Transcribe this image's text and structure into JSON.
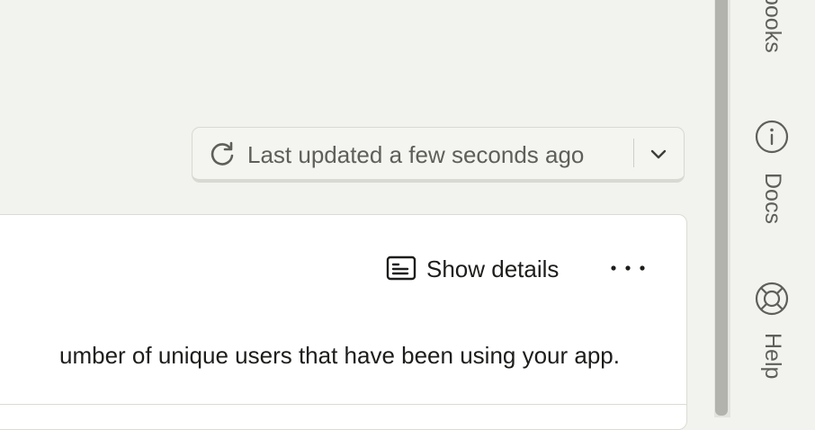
{
  "refresh": {
    "label": "Last updated a few seconds ago",
    "reload_icon": "reload-icon",
    "dropdown_icon": "chevron-down-icon"
  },
  "card": {
    "show_details_label": "Show details",
    "show_details_icon": "details-panel-icon",
    "more_icon": "more-horizontal-icon",
    "description": "umber of unique users that have been using your app."
  },
  "rail": {
    "items": [
      {
        "label": "books",
        "icon": ""
      },
      {
        "label": "Docs",
        "icon": "info-icon"
      },
      {
        "label": "Help",
        "icon": "lifebuoy-icon"
      }
    ]
  },
  "colors": {
    "background": "#f2f2ee",
    "card": "#ffffff",
    "muted_text": "#5f5f5a",
    "text": "#1d1d1b",
    "scroll_thumb": "#b3b3ae"
  }
}
